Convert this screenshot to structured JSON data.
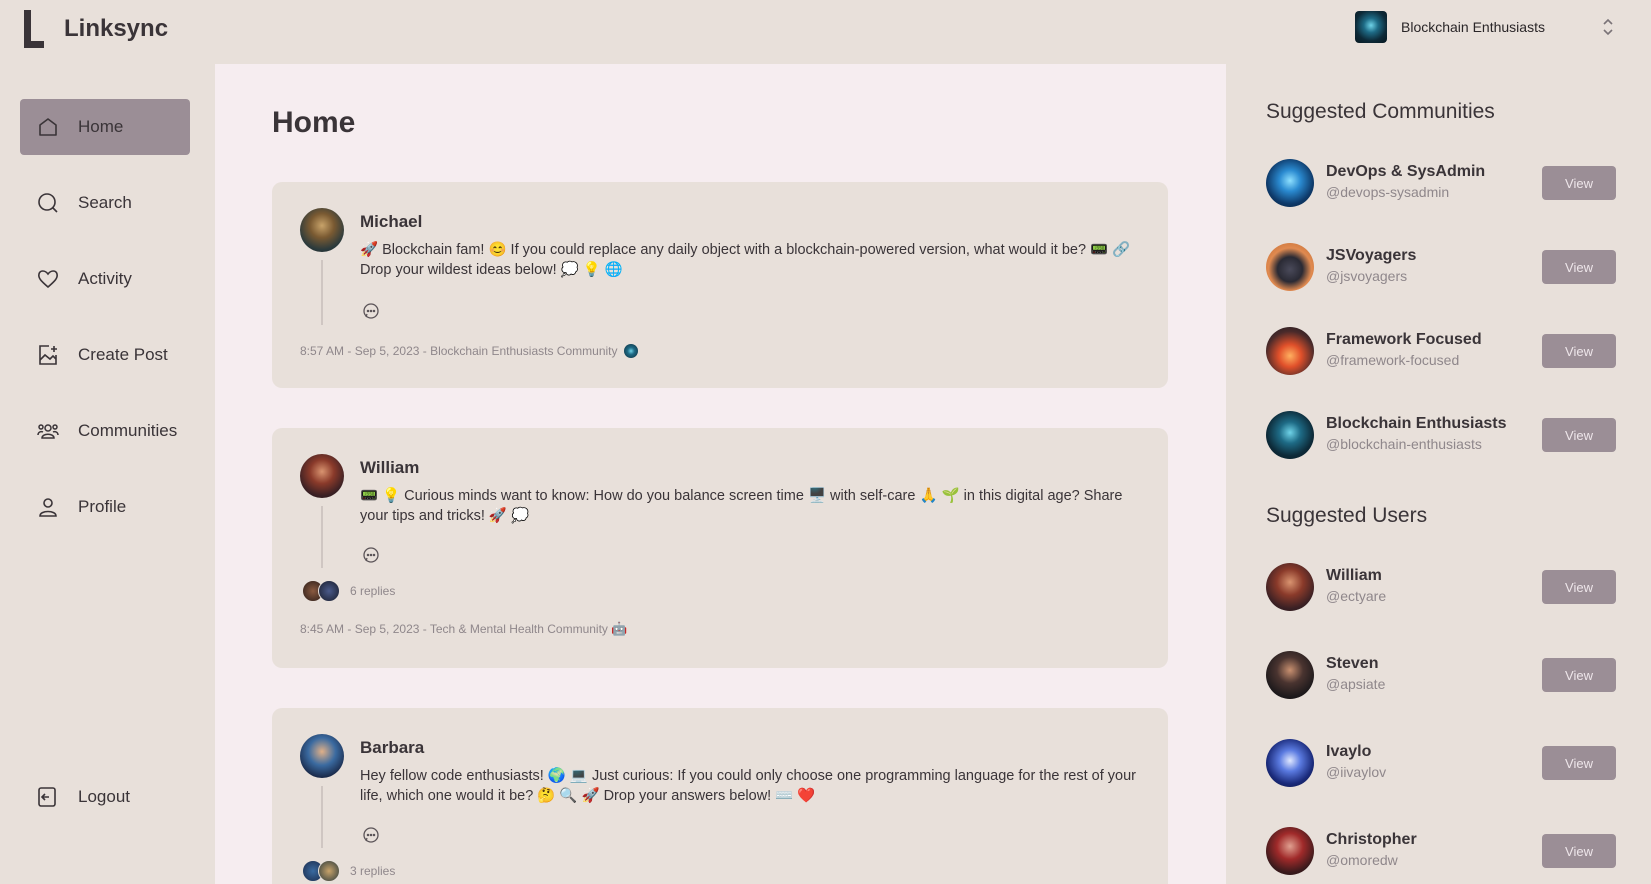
{
  "app": {
    "name": "Linksync"
  },
  "org_switcher": {
    "name": "Blockchain Enthusiasts"
  },
  "nav": {
    "items": [
      {
        "label": "Home",
        "icon": "home-icon"
      },
      {
        "label": "Search",
        "icon": "search-icon"
      },
      {
        "label": "Activity",
        "icon": "heart-icon"
      },
      {
        "label": "Create Post",
        "icon": "create-post-icon"
      },
      {
        "label": "Communities",
        "icon": "communities-icon"
      },
      {
        "label": "Profile",
        "icon": "profile-icon"
      }
    ],
    "logout": "Logout"
  },
  "main": {
    "title": "Home",
    "posts": [
      {
        "author": "Michael",
        "content": "🚀 Blockchain fam! 😊 If you could replace any daily object with a blockchain-powered version, what would it be? 📟 🔗 Drop your wildest ideas below! 💭 💡 🌐",
        "replies": "",
        "meta": "8:57 AM - Sep 5, 2023 - Blockchain Enthusiasts Community"
      },
      {
        "author": "William",
        "content": "📟 💡 Curious minds want to know: How do you balance screen time 🖥️ with self-care 🙏 🌱 in this digital age? Share your tips and tricks! 🚀 💭",
        "replies": "6 replies",
        "meta": "8:45 AM - Sep 5, 2023 - Tech & Mental Health Community"
      },
      {
        "author": "Barbara",
        "content": "Hey fellow code enthusiasts! 🌍 💻 Just curious: If you could only choose one programming language for the rest of your life, which one would it be? 🤔 🔍 🚀 Drop your answers below! ⌨️ ❤️",
        "replies": "3 replies",
        "meta": ""
      }
    ]
  },
  "suggested_communities": {
    "title": "Suggested Communities",
    "items": [
      {
        "name": "DevOps & SysAdmin",
        "handle": "@devops-sysadmin",
        "button": "View"
      },
      {
        "name": "JSVoyagers",
        "handle": "@jsvoyagers",
        "button": "View"
      },
      {
        "name": "Framework Focused",
        "handle": "@framework-focused",
        "button": "View"
      },
      {
        "name": "Blockchain Enthusiasts",
        "handle": "@blockchain-enthusiasts",
        "button": "View"
      }
    ]
  },
  "suggested_users": {
    "title": "Suggested Users",
    "items": [
      {
        "name": "William",
        "handle": "@ectyare",
        "button": "View"
      },
      {
        "name": "Steven",
        "handle": "@apsiate",
        "button": "View"
      },
      {
        "name": "Ivaylo",
        "handle": "@iivaylov",
        "button": "View"
      },
      {
        "name": "Christopher",
        "handle": "@omoredw",
        "button": "View"
      }
    ]
  },
  "colors": {
    "background": "#e8e0da",
    "main_panel": "#f6edf0",
    "accent": "#9b8e96",
    "text": "#3a3438",
    "muted": "#8f878b"
  }
}
